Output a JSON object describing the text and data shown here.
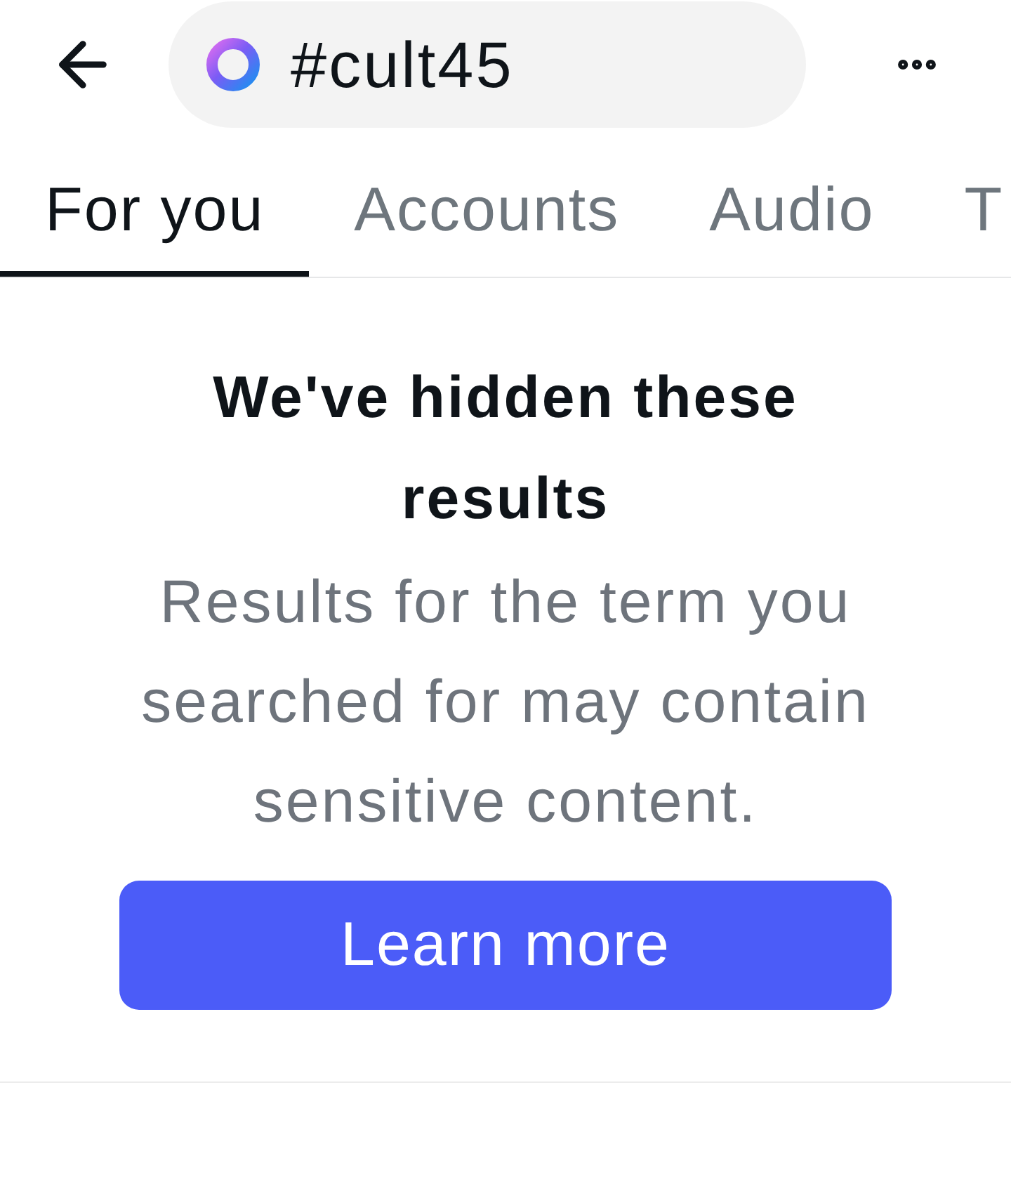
{
  "header": {
    "search": {
      "value": "#cult45"
    }
  },
  "tabs": [
    {
      "label": "For you",
      "selected": true
    },
    {
      "label": "Accounts",
      "selected": false
    },
    {
      "label": "Audio",
      "selected": false
    },
    {
      "label": "T",
      "selected": false
    }
  ],
  "notice": {
    "title": "We've hidden these results",
    "message": "Results for the term you searched for may contain sensitive content.",
    "button": "Learn more"
  }
}
